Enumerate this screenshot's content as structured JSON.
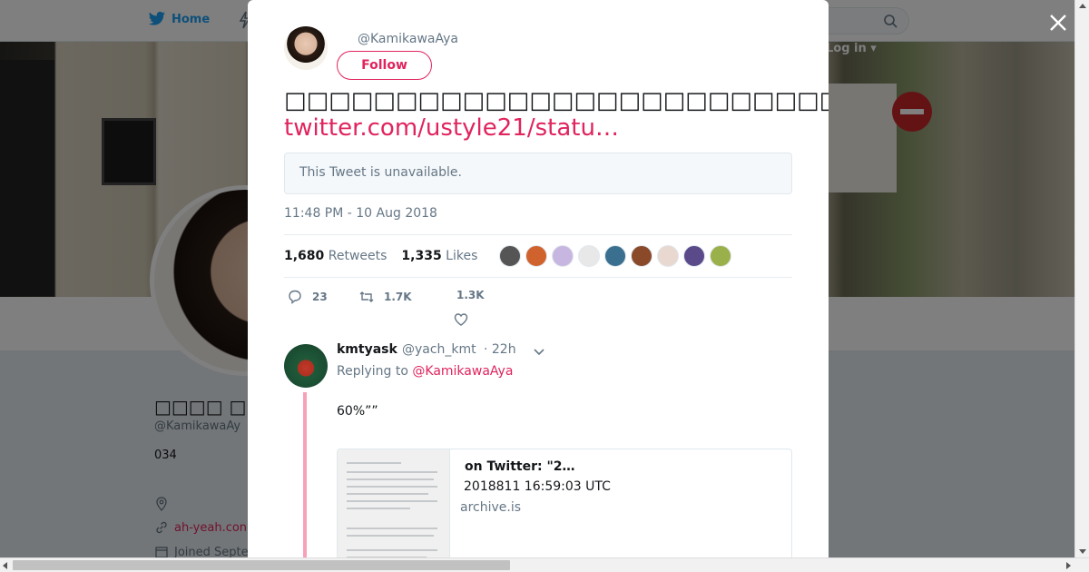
{
  "nav": {
    "home_label": "Home",
    "login_label": "Log in ▾"
  },
  "profile": {
    "name": "□□□□ □□□□",
    "handle": "@KamikawaAy",
    "bio": "034",
    "link_text": "ah-yeah.con",
    "joined_text": "Joined Septe"
  },
  "tweet": {
    "handle": "@KamikawaAya",
    "follow_label": "Follow",
    "text": "□□□□□□□□□□□□□□□□□□□□□□□□□□□□□□□□□□□□□□□□□□□□□□□□□",
    "link": "twitter.com/ustyle21/statu…",
    "quoted_unavailable": "This Tweet is unavailable.",
    "timestamp": "11:48 PM - 10 Aug 2018",
    "retweets_count": "1,680",
    "retweets_label": "Retweets",
    "likes_count": "1,335",
    "likes_label": "Likes",
    "reply_count": "23",
    "retweet_action_count": "1.7K",
    "like_action_count": "1.3K"
  },
  "likers": {
    "colors": [
      "#555555",
      "#d0622e",
      "#c7b6e0",
      "#e8e8e8",
      "#3b6f8f",
      "#8a4a2a",
      "#e9d8d0",
      "#5a4a8a",
      "#9ab04a"
    ]
  },
  "reply": {
    "name": "kmtyask",
    "handle": "@yach_kmt",
    "time": "· 22h",
    "replying_prefix": "Replying to",
    "replying_to": "@KamikawaAya",
    "text": "60%””",
    "card_title": "on Twitter: \"2…",
    "card_desc": "2018811 16:59:03 UTC",
    "card_domain": "archive.is"
  },
  "colors": {
    "accent": "#e0245e",
    "twitter_blue": "#1da1f2",
    "thread_line": "#f7a1b8"
  }
}
